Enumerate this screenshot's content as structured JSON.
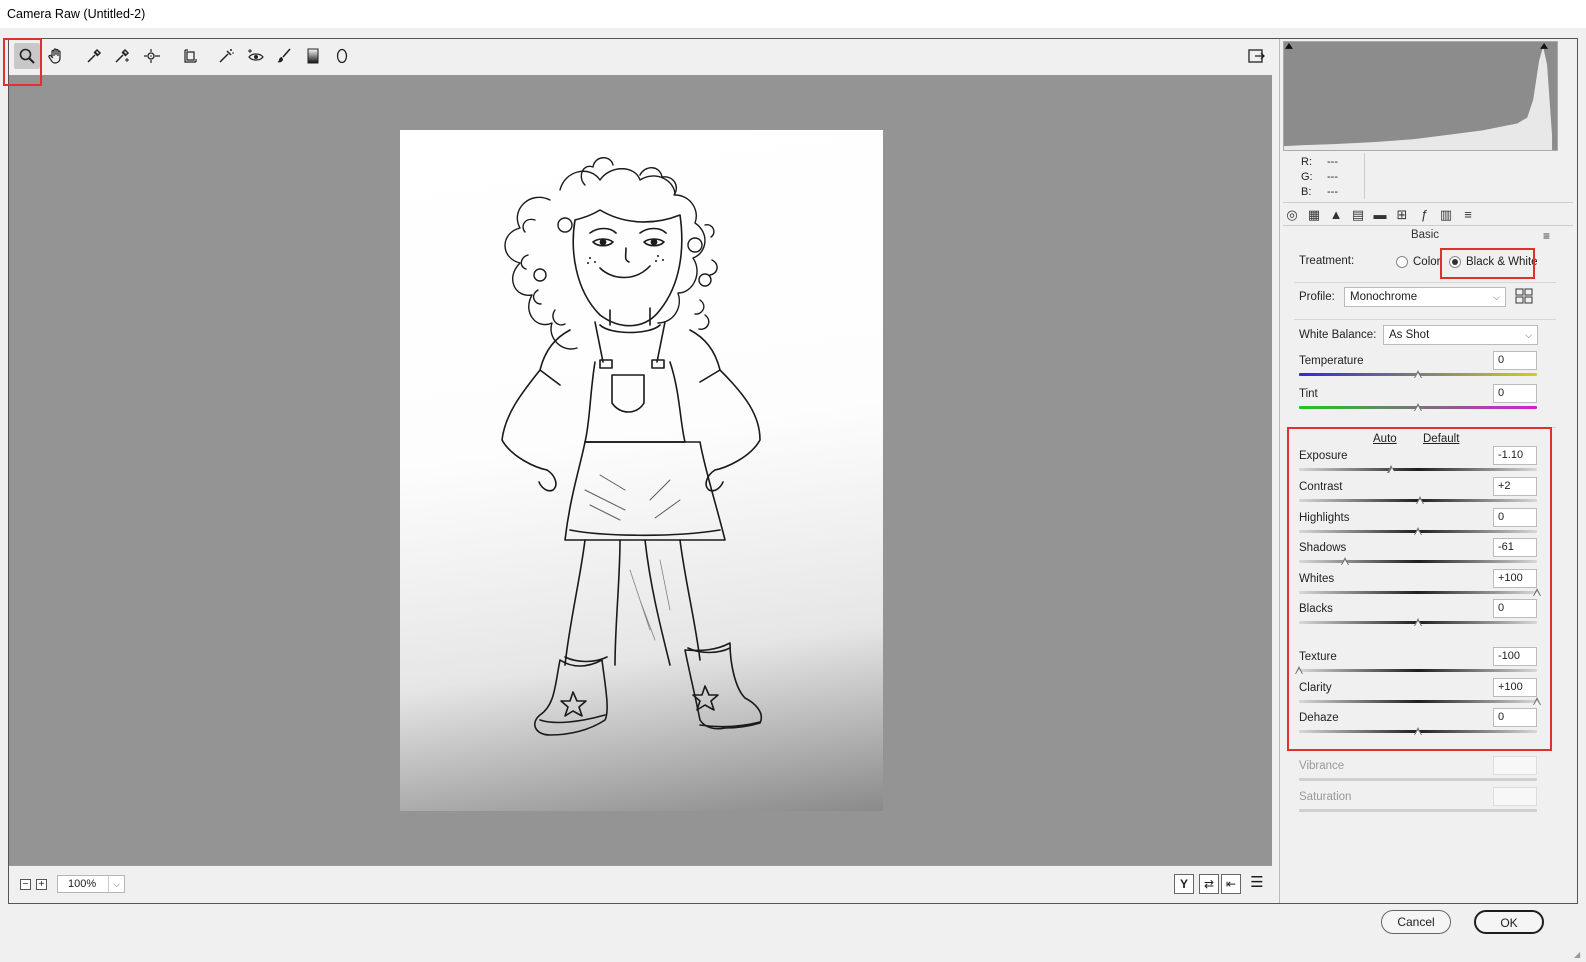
{
  "window": {
    "title": "Camera Raw (Untitled-2)"
  },
  "toolbar": {
    "tools": [
      {
        "name": "zoom-tool-icon",
        "active": true
      },
      {
        "name": "hand-tool-icon"
      },
      {
        "name": "white-balance-eyedropper-icon"
      },
      {
        "name": "color-sampler-icon"
      },
      {
        "name": "targeted-adjustment-icon"
      },
      {
        "name": "transform-tool-icon"
      },
      {
        "name": "spot-removal-icon"
      },
      {
        "name": "red-eye-icon"
      },
      {
        "name": "adjustment-brush-icon"
      },
      {
        "name": "graduated-filter-icon"
      },
      {
        "name": "radial-filter-icon"
      }
    ],
    "right_icon": "open-preferences-icon"
  },
  "statusbar": {
    "zoom_out": "−",
    "zoom_in": "+",
    "zoom_value": "100%",
    "icons": [
      "before-after-y-icon",
      "swap-before-after-icon",
      "copy-settings-icon",
      "preview-settings-icon"
    ],
    "y_label": "Y"
  },
  "info": {
    "r_label": "R:",
    "r_value": "---",
    "g_label": "G:",
    "g_value": "---",
    "b_label": "B:",
    "b_value": "---"
  },
  "panel": {
    "title": "Basic",
    "tabs": [
      "basic-panel-icon",
      "tone-curve-icon",
      "detail-icon",
      "hsl-icon",
      "split-toning-icon",
      "lens-corrections-icon",
      "effects-icon",
      "camera-calibration-icon",
      "presets-icon"
    ],
    "treatment_label": "Treatment:",
    "treatment_color": "Color",
    "treatment_bw": "Black & White",
    "treatment_selected": "Black & White",
    "profile_label": "Profile:",
    "profile_value": "Monochrome",
    "wb_label": "White Balance:",
    "wb_value": "As Shot",
    "auto": "Auto",
    "default": "Default",
    "sliders": [
      {
        "key": "temperature",
        "label": "Temperature",
        "value": "0",
        "pos": 0.5,
        "track": "temp"
      },
      {
        "key": "tint",
        "label": "Tint",
        "value": "0",
        "pos": 0.5,
        "track": "tint"
      },
      {
        "key": "exposure",
        "label": "Exposure",
        "value": "-1.10",
        "pos": 0.39
      },
      {
        "key": "contrast",
        "label": "Contrast",
        "value": "+2",
        "pos": 0.51
      },
      {
        "key": "highlights",
        "label": "Highlights",
        "value": "0",
        "pos": 0.5
      },
      {
        "key": "shadows",
        "label": "Shadows",
        "value": "-61",
        "pos": 0.195
      },
      {
        "key": "whites",
        "label": "Whites",
        "value": "+100",
        "pos": 1.0
      },
      {
        "key": "blacks",
        "label": "Blacks",
        "value": "0",
        "pos": 0.5
      },
      {
        "key": "texture",
        "label": "Texture",
        "value": "-100",
        "pos": 0.0
      },
      {
        "key": "clarity",
        "label": "Clarity",
        "value": "+100",
        "pos": 1.0
      },
      {
        "key": "dehaze",
        "label": "Dehaze",
        "value": "0",
        "pos": 0.5
      },
      {
        "key": "vibrance",
        "label": "Vibrance",
        "value": "",
        "disabled": true
      },
      {
        "key": "saturation",
        "label": "Saturation",
        "value": "",
        "disabled": true
      }
    ]
  },
  "buttons": {
    "cancel": "Cancel",
    "ok": "OK"
  }
}
